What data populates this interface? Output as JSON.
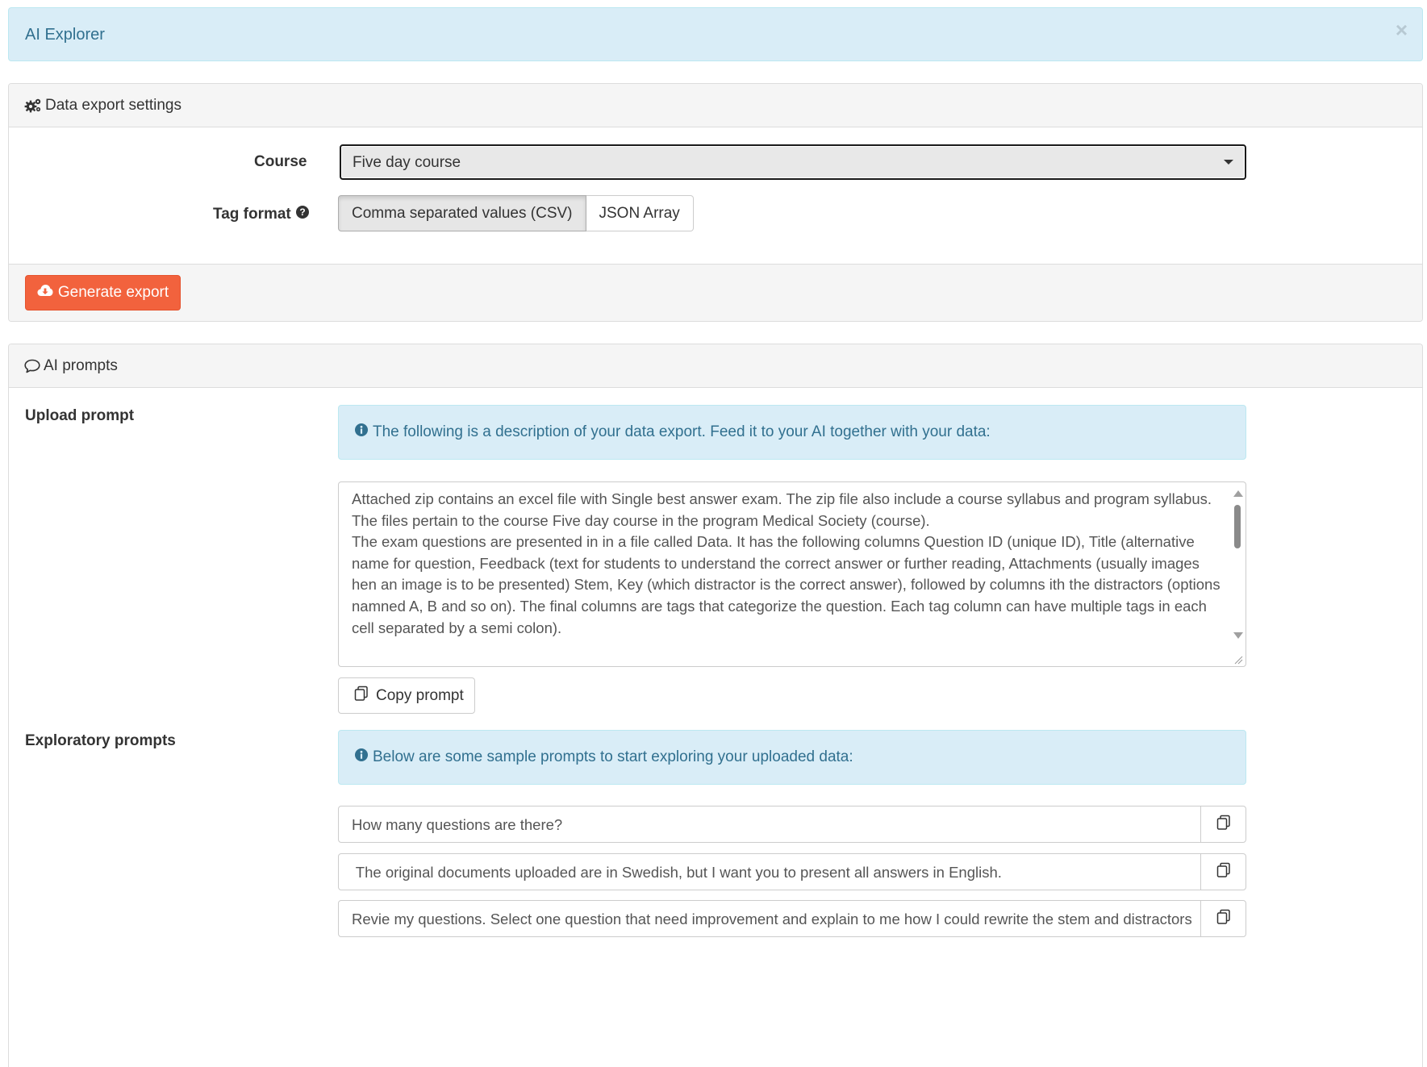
{
  "top_alert": {
    "title": "AI Explorer",
    "close": "×"
  },
  "export_panel": {
    "heading": "Data export settings",
    "course_label": "Course",
    "course_value": "Five day course",
    "tag_format_label": "Tag format",
    "tag_options": [
      "Comma separated values (CSV)",
      "JSON Array"
    ],
    "tag_selected": "Comma separated values (CSV)",
    "generate_button": "Generate export"
  },
  "prompts_panel": {
    "heading": "AI prompts",
    "upload_label": "Upload prompt",
    "upload_info": "The following is a description of your data export. Feed it to your AI together with your data:",
    "upload_text": [
      "Attached zip contains an excel file with Single best answer exam. The zip file also include a course syllabus and program syllabus.",
      "The files pertain to the course Five day course  in the program Medical Society (course).",
      "The exam questions are presented in in a file called Data. It has the following columns Question ID (unique ID), Title (alternative name for question, Feedback (text for students to understand the correct answer or further reading, Attachments (usually images hen an image is to be presented)    Stem, Key (which distractor is the correct answer), followed by columns ith the distractors (options namned A, B and so on). The final columns are tags that categorize the question. Each tag column can have multiple tags in each cell separated by a semi colon)."
    ],
    "copy_button": "Copy prompt",
    "exploratory_label": "Exploratory prompts",
    "exploratory_info": "Below are some sample prompts to start exploring your uploaded data:",
    "samples": [
      "How many questions are there?",
      " The original documents uploaded are in Swedish, but I want you to present all answers in English.",
      "Revie my questions. Select one question that need improvement and explain to me how I could rewrite the stem and distractors"
    ]
  },
  "colors": {
    "info_bg": "#d9edf7",
    "info_text": "#31708f",
    "primary_button": "#f2623d",
    "panel_heading_bg": "#f5f5f5"
  },
  "icons": {
    "settings": "gears-icon",
    "help": "question-circle-icon",
    "generate": "cloud-download-icon",
    "prompts": "comment-icon",
    "info": "info-circle-icon",
    "copy": "copy-icon"
  }
}
